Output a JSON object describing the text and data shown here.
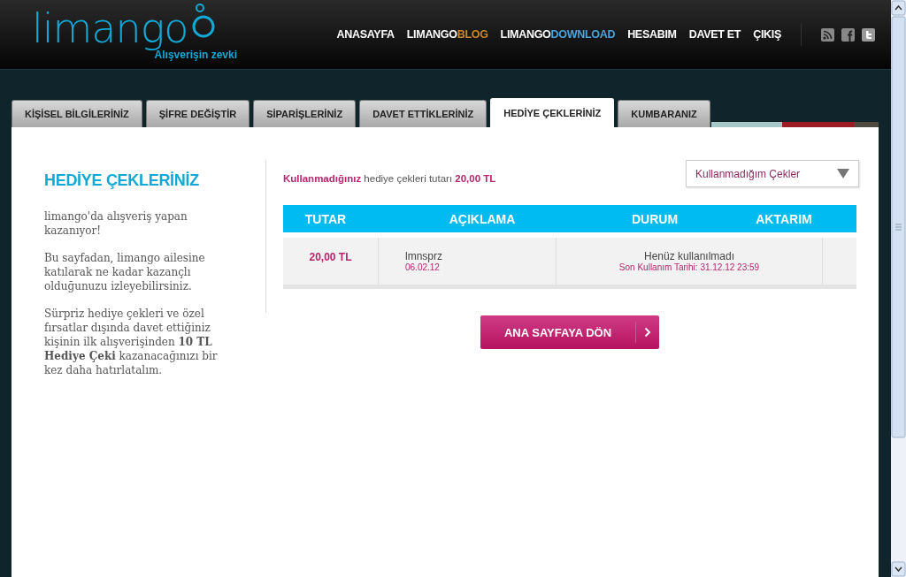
{
  "header": {
    "logo": "limango",
    "tagline": "Alışverişin zevki",
    "nav": [
      {
        "label": "ANASAYFA"
      },
      {
        "label": "LIMANGO",
        "accent": "BLOG",
        "color": "#c8872a"
      },
      {
        "label": "LIMANGO",
        "accent": "DOWNLOAD",
        "color": "#4aa3d9"
      },
      {
        "label": "HESABIM"
      },
      {
        "label": "DAVET ET"
      },
      {
        "label": "ÇIKIŞ"
      }
    ]
  },
  "tabs": [
    {
      "label": "KİŞİSEL BİLGİLERİNİZ",
      "selected": false
    },
    {
      "label": "ŞİFRE DEĞİŞTİR",
      "selected": false
    },
    {
      "label": "SİPARİŞLERİNİZ",
      "selected": false
    },
    {
      "label": "DAVET ETTİKLERİNİZ",
      "selected": false
    },
    {
      "label": "HEDİYE ÇEKLERİNİZ",
      "selected": true
    },
    {
      "label": "KUMBARANIZ",
      "selected": false
    }
  ],
  "sidebar": {
    "title": "HEDİYE ÇEKLERİNİZ",
    "paragraphs": [
      "limango'da alışveriş yapan kazanıyor!",
      "Bu sayfadan, limango ailesine katılarak ne kadar kazançlı olduğunuzu izleyebilirsiniz.",
      "Sürpriz hediye çekleri ve özel fırsatlar dışında davet ettiğiniz kişinin ilk alışverişinden **10 TL Hediye Çeki** kazanacağınızı bir kez daha hatırlatalım."
    ]
  },
  "summary": "**Kullanmadığınız** hediye çekleri tutarı **20,00 TL**",
  "filter": {
    "value": "Kullanmadığım Çekler"
  },
  "table": {
    "columns": [
      "TUTAR",
      "AÇIKLAMA",
      "DURUM",
      "AKTARIM"
    ],
    "rows": [
      {
        "amount": "20,00 TL",
        "description": "lmnsprz",
        "date": "06.02.12",
        "status": "Henüz kullanılmadı",
        "deadline": "Son Kullanım Tarihi: 31.12.12 23:59"
      }
    ]
  },
  "back_button": "ANA SAYFAYA DÖN"
}
